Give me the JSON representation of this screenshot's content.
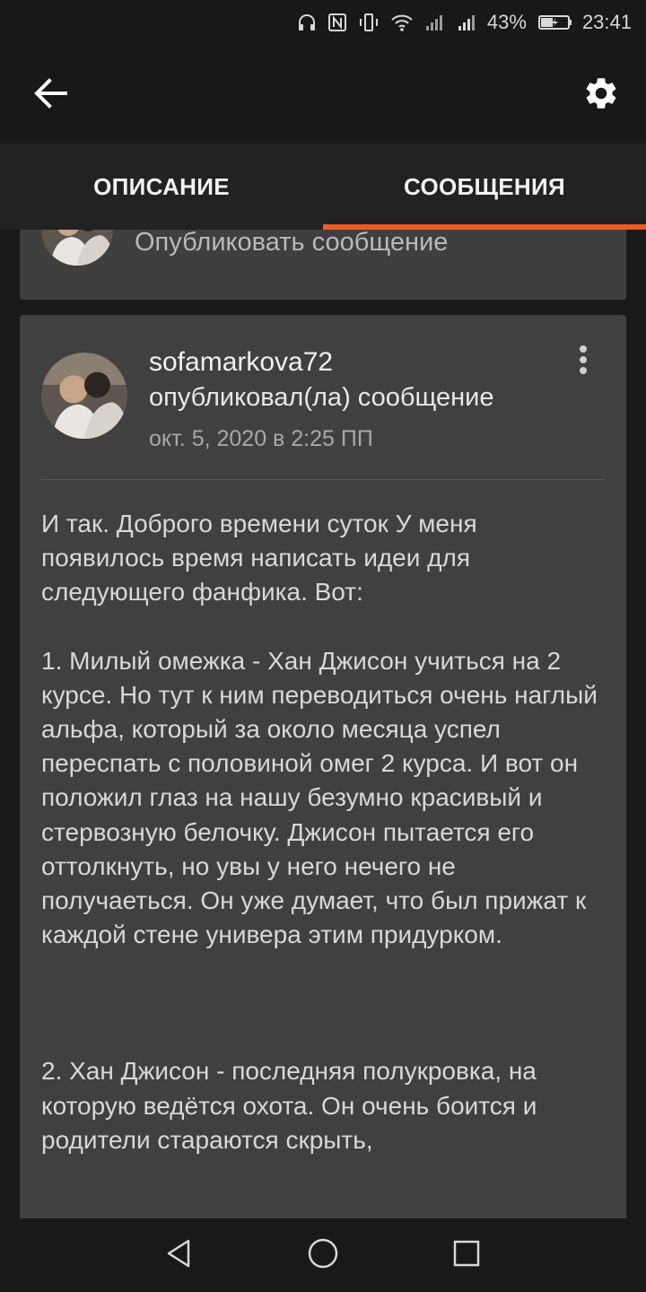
{
  "status_bar": {
    "battery": "43%",
    "time": "23:41",
    "icons": [
      "headset-icon",
      "nfc-icon",
      "vibrate-icon",
      "wifi-icon",
      "signal-icon",
      "signal-icon",
      "battery-icon"
    ]
  },
  "app_bar": {
    "back_icon": "arrow-left-icon",
    "settings_icon": "gear-icon"
  },
  "tabs": [
    {
      "label": "ОПИСАНИЕ",
      "active": false
    },
    {
      "label": "СООБЩЕНИЯ",
      "active": true
    }
  ],
  "colors": {
    "accent": "#ee5a24",
    "card": "#404040",
    "background": "#191919"
  },
  "composer": {
    "placeholder": "Опубликовать сообщение"
  },
  "post": {
    "author": "sofamarkova72",
    "action": "опубликовал(ла) сообщение",
    "date": "окт. 5, 2020 в 2:25 ПП",
    "paragraphs": [
      "И так. Доброго времени суток У меня появилось время написать идеи для следующего фанфика. Вот:",
      "1. Милый омежка - Хан Джисон учиться на 2 курсе. Но тут к ним переводиться очень наглый альфа, который за около месяца успел переспать с половиной омег 2 курса. И вот он положил глаз на нашу безумно красивый и стервозную белочку. Джисон пытается его оттолкнуть, но увы у него нечего не получаеться. Он уже думает, что был прижат к каждой стене универа этим придурком.",
      "2. Хан Джисон - последняя полукровка, на которую ведётся охота. Он очень боится и родители стараются скрыть,"
    ]
  },
  "nav_bar": {
    "icons": [
      "back-triangle-icon",
      "home-circle-icon",
      "recents-square-icon"
    ]
  }
}
